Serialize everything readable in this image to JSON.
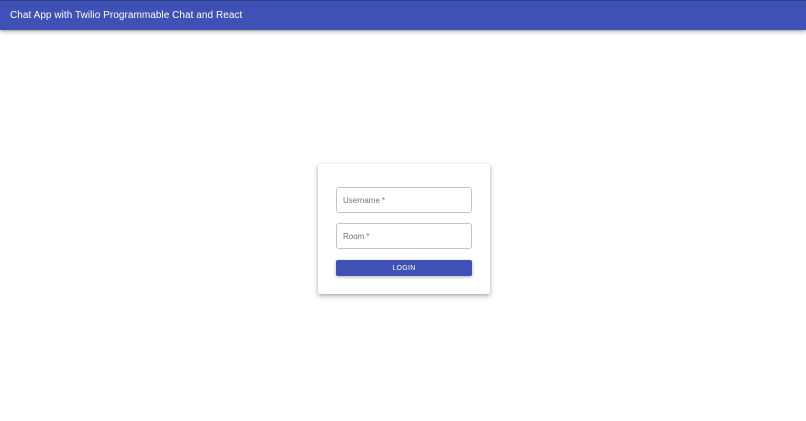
{
  "app_bar": {
    "title": "Chat App with Twilio Programmable Chat and React",
    "color": "#3f51b5"
  },
  "login_form": {
    "username_label": "Username",
    "username_value": "",
    "room_label": "Room",
    "room_value": "",
    "required_marker": "*",
    "login_label": "LOGIN",
    "button_color": "#3f51b5"
  }
}
